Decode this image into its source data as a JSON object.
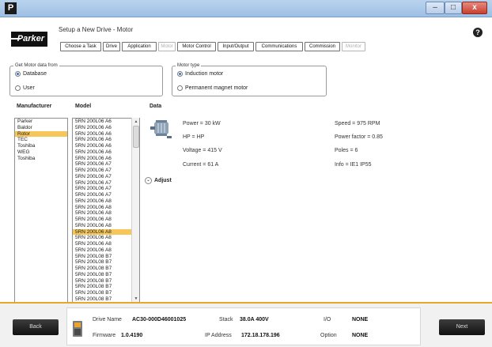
{
  "window": {
    "app_icon": "parker-app-icon",
    "min_label": "–",
    "max_label": "□",
    "close_label": "x"
  },
  "header": {
    "logo_text": "Parker",
    "title": "Setup a New Drive - Motor",
    "help_icon": "?",
    "tabs": [
      {
        "label": "Choose a Task",
        "enabled": true
      },
      {
        "label": "Drive",
        "enabled": true
      },
      {
        "label": "Application",
        "enabled": true
      },
      {
        "label": "Motor",
        "enabled": false
      },
      {
        "label": "Motor Control",
        "enabled": true
      },
      {
        "label": "Input/Output",
        "enabled": true
      },
      {
        "label": "Communications",
        "enabled": true
      },
      {
        "label": "Commission",
        "enabled": true
      },
      {
        "label": "Monitor",
        "enabled": false
      }
    ]
  },
  "source_group": {
    "label": "Get Motor data from",
    "options": [
      "Database",
      "User"
    ],
    "selected": "Database"
  },
  "motortype_group": {
    "label": "Motor type",
    "options": [
      "Induction motor",
      "Permanent magnet motor"
    ],
    "selected": "Induction motor"
  },
  "manufacturer": {
    "title": "Manufacturer",
    "items": [
      "Parker",
      "Baldor",
      "Rotor",
      "TEC",
      "Toshiba",
      "WEG",
      "Toshiba"
    ],
    "selected_index": 2
  },
  "model": {
    "title": "Model",
    "items": [
      "5RN 200L06 A6",
      "5RN 200L06 A6",
      "5RN 200L06 A6",
      "5RN 200L06 A6",
      "5RN 200L06 A6",
      "5RN 200L06 A6",
      "5RN 200L06 A6",
      "5RN 200L06 A7",
      "5RN 200L06 A7",
      "5RN 200L06 A7",
      "5RN 200L06 A7",
      "5RN 200L06 A7",
      "5RN 200L06 A7",
      "5RN 200L06 A8",
      "5RN 200L06 A8",
      "5RN 200L06 A8",
      "5RN 200L06 A8",
      "5RN 200L06 A8",
      "5RN 200L06 A8",
      "5RN 200L06 A8",
      "5RN 200L06 A8",
      "5RN 200L06 A8",
      "5RN 200L08 B7",
      "5RN 200L08 B7",
      "5RN 200L08 B7",
      "5RN 200L08 B7",
      "5RN 200L08 B7",
      "5RN 200L08 B7",
      "5RN 200L08 B7",
      "5RN 200L08 B7"
    ],
    "selected_index": 18
  },
  "data": {
    "title": "Data",
    "power": "Power =   30  kW",
    "hp": "HP =     HP",
    "voltage": "Voltage =  415  V",
    "current": "Current =   61  A",
    "speed": "Speed =  975  RPM",
    "power_factor": "Power factor =   0.85",
    "poles": "Poles =   6",
    "info": "Info =  IE1 IP55",
    "adjust_label": "Adjust",
    "adjust_icon": "⌄"
  },
  "footer": {
    "back_label": "Back",
    "next_label": "Next",
    "drive_name_label": "Drive Name",
    "drive_name_value": "AC30-000D46001025",
    "firmware_label": "Firmware",
    "firmware_value": "1.0.4190",
    "stack_label": "Stack",
    "stack_value": "38.0A 400V",
    "ip_label": "IP Address",
    "ip_value": "172.18.178.196",
    "io_label": "I/O",
    "io_value": "NONE",
    "option_label": "Option",
    "option_value": "NONE"
  },
  "colors": {
    "accent": "#e8a72a",
    "selection": "#f6c65a",
    "radio": "#3a6fc4"
  }
}
